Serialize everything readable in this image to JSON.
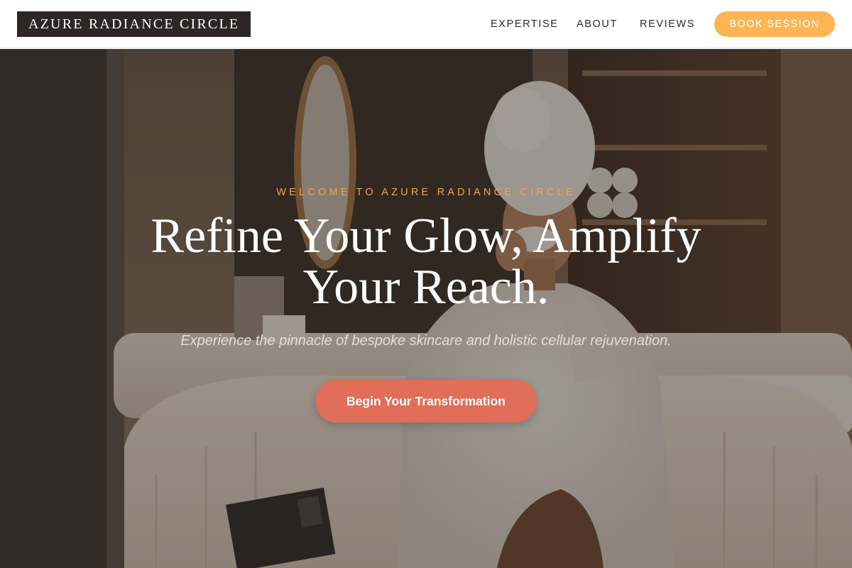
{
  "header": {
    "logo": "AZURE RADIANCE CIRCLE",
    "nav": [
      "EXPERTISE",
      "ABOUT",
      "REVIEWS"
    ],
    "cta": "BOOK SESSION"
  },
  "hero": {
    "eyebrow": "WELCOME TO AZURE RADIANCE CIRCLE",
    "headline_line1": "Refine Your Glow, Amplify",
    "headline_line2": "Your Reach.",
    "subtext": "Experience the pinnacle of bespoke skincare and holistic cellular rejuvenation.",
    "cta": "Begin Your Transformation"
  },
  "colors": {
    "logo_bg": "#2e2527",
    "book_button": "#fdb551",
    "eyebrow": "#f0a54a",
    "cta_button": "#e06e58"
  }
}
